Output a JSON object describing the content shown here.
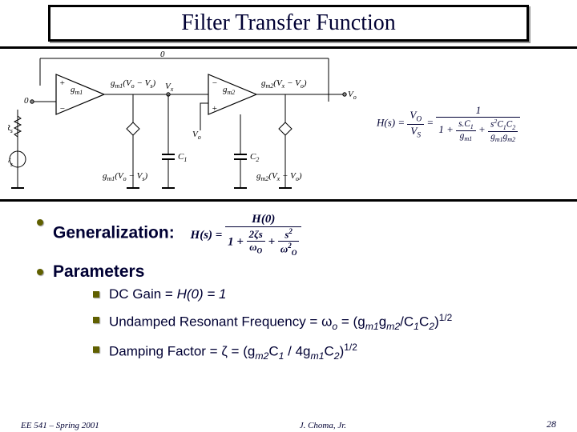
{
  "title": "Filter  Transfer  Function",
  "schematic": {
    "net_labels": {
      "zero_top": "0",
      "zero_in": "0",
      "gm1_label": "g",
      "gm1_sub": "m1",
      "gm2_label": "g",
      "gm2_sub": "m2",
      "Rs": "R",
      "Rs_sub": "s",
      "Vs": "V",
      "Vs_sub": "s",
      "Vx": "V",
      "Vx_sub": "x",
      "Vo": "V",
      "Vo_sub": "o",
      "C1": "C",
      "C1_sub": "1",
      "C2": "C",
      "C2_sub": "2",
      "i1": "g",
      "i1_sub": "m1",
      "i1_expr": "(V",
      "i1_expr2": " − V",
      "i1_close": ")",
      "i1b": "g",
      "i1b_sub": "m1",
      "i1b_expr": "(V",
      "i1b_close": ")",
      "i2": "g",
      "i2_sub": "m2",
      "i2_expr": "(V",
      "i2_close": ")",
      "i2b": "g",
      "i2b_sub": "m2",
      "i2b_expr": "(V",
      "i2b_close": ")"
    }
  },
  "equation_main": {
    "lhs_num": "V",
    "lhs_num_sub": "O",
    "lhs_den": "V",
    "lhs_den_sub": "S",
    "rhs_num": "1",
    "d1a": "s.C",
    "d1a_sub": "1",
    "d1b": "g",
    "d1b_sub": "m1",
    "d2a": "s",
    "d2a_sup": "2",
    "d2b": "C",
    "d2b_sub": "1",
    "d2c": "C",
    "d2c_sub": "2",
    "d2d": "g",
    "d2d_sub": "m1",
    "d2e": "g",
    "d2e_sub": "m2",
    "Hs": "H(s) ="
  },
  "bullets": {
    "generalization": "Generalization:",
    "parameters": "Parameters"
  },
  "gen_eqn": {
    "lhs": "H(s) =",
    "num": "H(0)",
    "d0": "1 +",
    "d1a": "2ζs",
    "d1b": "ω",
    "d1b_sub": "O",
    "d2a": "s",
    "d2a_sup": "2",
    "d2b": "ω",
    "d2b_sub": "O",
    "d2b_sup": "2"
  },
  "subbullets": {
    "dc": {
      "label": "DC Gain = ",
      "expr": "H(0) = 1"
    },
    "wo": {
      "label": "Undamped Resonant Frequency = ",
      "sym": "ω",
      "sym_sub": "o",
      "eq": " = (g",
      "g1_sub": "m1",
      "mid": "g",
      "g2_sub": "m2",
      "over": "/C",
      "c1_sub": "1",
      "c2": "C",
      "c2_sub": "2",
      "close": ")",
      "pow": "1/2"
    },
    "zeta": {
      "label": "Damping Factor = ",
      "sym": "ζ",
      "eq": " = (g",
      "g2_sub": "m2",
      "c1": "C",
      "c1_sub": "1",
      "over": " / 4",
      "g1": "g",
      "g1_sub": "m1",
      "c2": "C",
      "c2_sub": "2",
      "close": ")",
      "pow": "1/2"
    }
  },
  "footer": {
    "left": "EE 541 – Spring 2001",
    "center": "J. Choma, Jr.",
    "right": "28"
  }
}
